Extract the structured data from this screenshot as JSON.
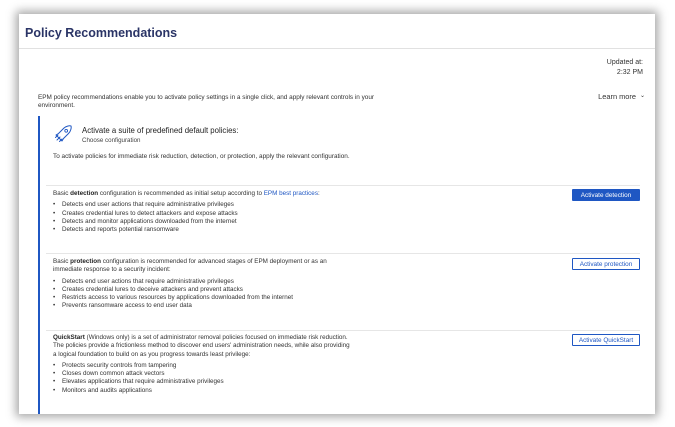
{
  "page": {
    "title": "Policy Recommendations",
    "updated_label": "Updated at:",
    "updated_time": "2:32 PM",
    "intro": "EPM policy recommendations enable you to activate policy settings in a single click, and apply relevant controls in your environment.",
    "learn_more": "Learn more"
  },
  "card": {
    "icon": "rocket-icon",
    "title": "Activate a suite of predefined default policies:",
    "subtitle": "Choose configuration",
    "description": "To activate policies for immediate risk reduction, detection, or protection, apply the relevant configuration."
  },
  "detection": {
    "prefix": "Basic ",
    "keyword": "detection",
    "text": " configuration is recommended as initial setup according to ",
    "link": "EPM best practices",
    "suffix": ":",
    "button": "Activate detection",
    "items": [
      "Detects end user actions that require administrative privileges",
      "Creates credential lures to detect attackers and expose attacks",
      "Detects and monitor applications downloaded from the internet",
      "Detects and reports potential ransomware"
    ]
  },
  "protection": {
    "prefix": "Basic ",
    "keyword": "protection",
    "text": " configuration is recommended for advanced stages of EPM deployment or as an immediate response to a security incident:",
    "button": "Activate protection",
    "items": [
      "Detects end user actions that require administrative privileges",
      "Creates credential lures to deceive attackers and prevent attacks",
      "Restricts access to various resources by applications downloaded from the internet",
      "Prevents ransomware access to end user data"
    ]
  },
  "quickstart": {
    "keyword": "QuickStart",
    "text": " (Windows only) is a set of administrator removal policies focused on immediate risk reduction. The policies provide a frictionless method to discover end users' administration needs, while also providing a logical foundation to build on as you progress towards least privilege:",
    "button": "Activate QuickStart",
    "items": [
      "Protects security controls from tampering",
      "Closes down common attack vectors",
      "Elevates applications that require administrative privileges",
      "Monitors and audits applications"
    ]
  },
  "colors": {
    "accent": "#1f57c3",
    "title": "#2a3466"
  }
}
